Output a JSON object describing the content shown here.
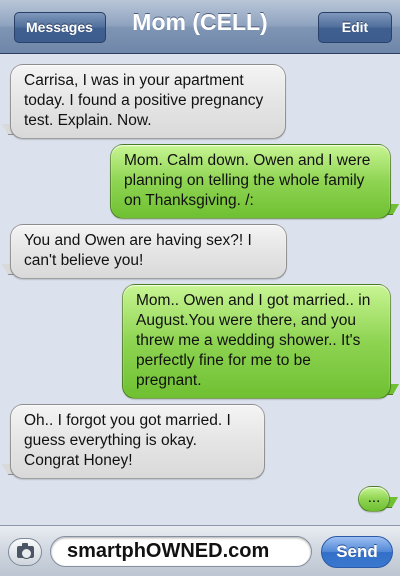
{
  "navbar": {
    "back_label": "Messages",
    "title": "Mom (CELL)",
    "edit_label": "Edit"
  },
  "messages": [
    {
      "from": "contact",
      "text": "Carrisa, I was in your apartment today. I found a positive pregnancy test. Explain. Now."
    },
    {
      "from": "me",
      "text": "Mom. Calm down. Owen and I were planning on telling the whole family on Thanksgiving. /:"
    },
    {
      "from": "contact",
      "text": "You and Owen are having sex?! I can't believe you!"
    },
    {
      "from": "me",
      "text": "Mom.. Owen and I got married.. in August.You were there, and you threw me a wedding shower.. It's perfectly fine for me to be pregnant."
    },
    {
      "from": "contact",
      "text": "Oh.. I forgot you got married. I guess everything is okay. Congrat Honey!"
    },
    {
      "from": "me",
      "text": "..."
    }
  ],
  "input": {
    "value": "smartphOWNED.com",
    "send_label": "Send",
    "camera_icon": "camera-icon"
  },
  "colors": {
    "sent_bubble": "#8ed452",
    "received_bubble": "#e5e5e5",
    "send_button": "#3a78cf",
    "nav_bar": "#7f95b4"
  }
}
